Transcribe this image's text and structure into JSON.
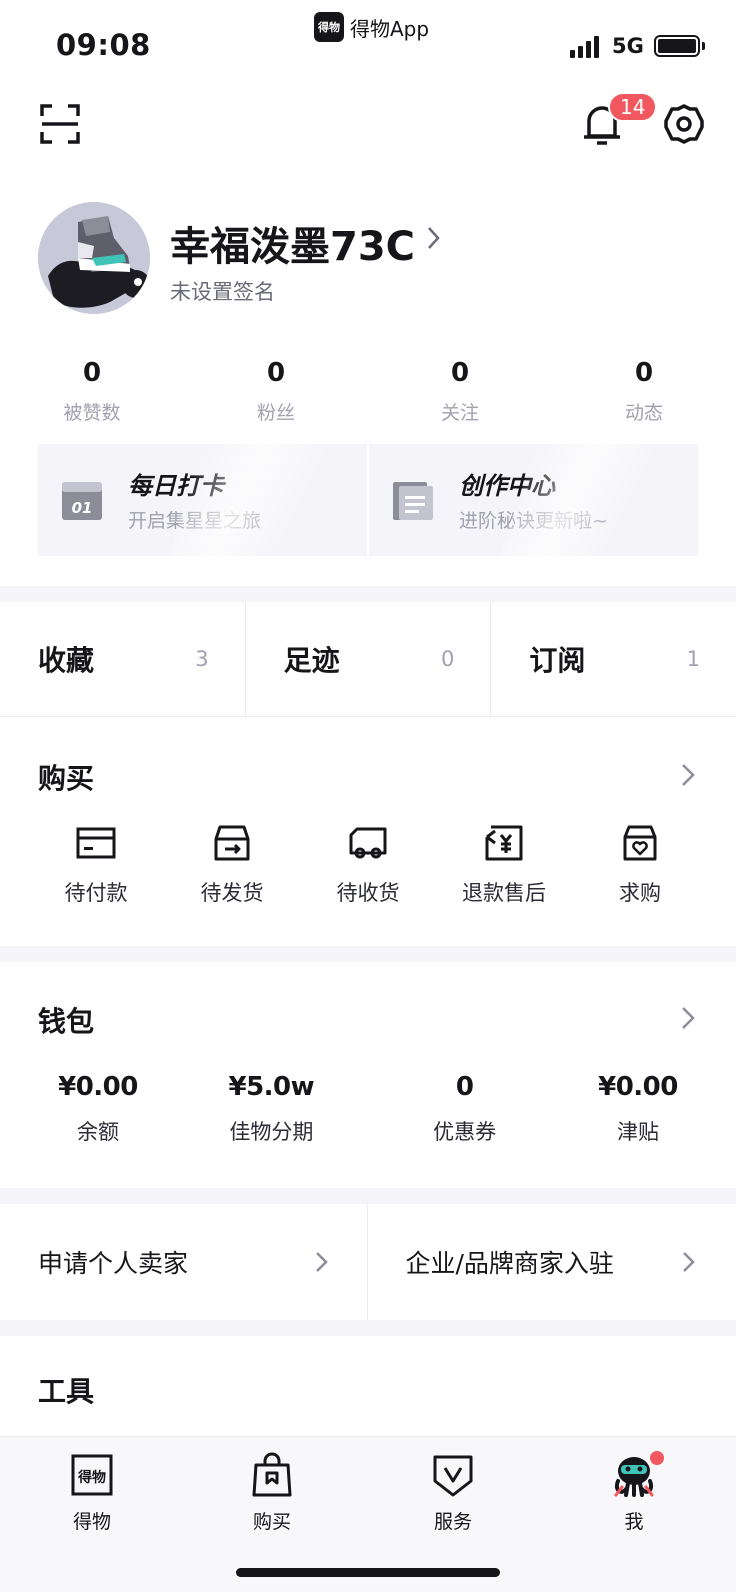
{
  "status_bar": {
    "time": "09:08",
    "app_name": "得物App",
    "app_logo_text": "得物",
    "network": "5G"
  },
  "header": {
    "notification_count": "14"
  },
  "profile": {
    "username": "幸福泼墨73C",
    "signature": "未设置签名",
    "stats": [
      {
        "value": "0",
        "label": "被赞数"
      },
      {
        "value": "0",
        "label": "粉丝"
      },
      {
        "value": "0",
        "label": "关注"
      },
      {
        "value": "0",
        "label": "动态"
      }
    ],
    "cards": [
      {
        "title": "每日打卡",
        "subtitle": "开启集星星之旅",
        "icon_text": "01"
      },
      {
        "title": "创作中心",
        "subtitle": "进阶秘诀更新啦~"
      }
    ]
  },
  "quick_links": [
    {
      "label": "收藏",
      "count": "3"
    },
    {
      "label": "足迹",
      "count": "0"
    },
    {
      "label": "订阅",
      "count": "1"
    }
  ],
  "buy": {
    "title": "购买",
    "items": [
      {
        "label": "待付款",
        "icon": "card-icon"
      },
      {
        "label": "待发货",
        "icon": "box-icon"
      },
      {
        "label": "待收货",
        "icon": "truck-icon"
      },
      {
        "label": "退款售后",
        "icon": "refund-icon"
      },
      {
        "label": "求购",
        "icon": "heart-box-icon"
      }
    ]
  },
  "wallet": {
    "title": "钱包",
    "items": [
      {
        "value": "¥0.00",
        "label": "余额"
      },
      {
        "value": "¥5.0w",
        "label": "佳物分期"
      },
      {
        "value": "0",
        "label": "优惠券"
      },
      {
        "value": "¥0.00",
        "label": "津贴"
      }
    ]
  },
  "seller": [
    {
      "label": "申请个人卖家"
    },
    {
      "label": "企业/品牌商家入驻"
    }
  ],
  "tools": {
    "title": "工具"
  },
  "tabbar": [
    {
      "label": "得物",
      "icon": "dewu-logo-icon",
      "icon_text": "得物"
    },
    {
      "label": "购买",
      "icon": "shopping-bag-icon"
    },
    {
      "label": "服务",
      "icon": "shield-v-icon"
    },
    {
      "label": "我",
      "icon": "avatar-mascot-icon"
    }
  ],
  "colors": {
    "badge": "#f0575f",
    "text_primary": "#16161a",
    "text_secondary": "#a1a1b0",
    "background": "#f5f5f9"
  }
}
